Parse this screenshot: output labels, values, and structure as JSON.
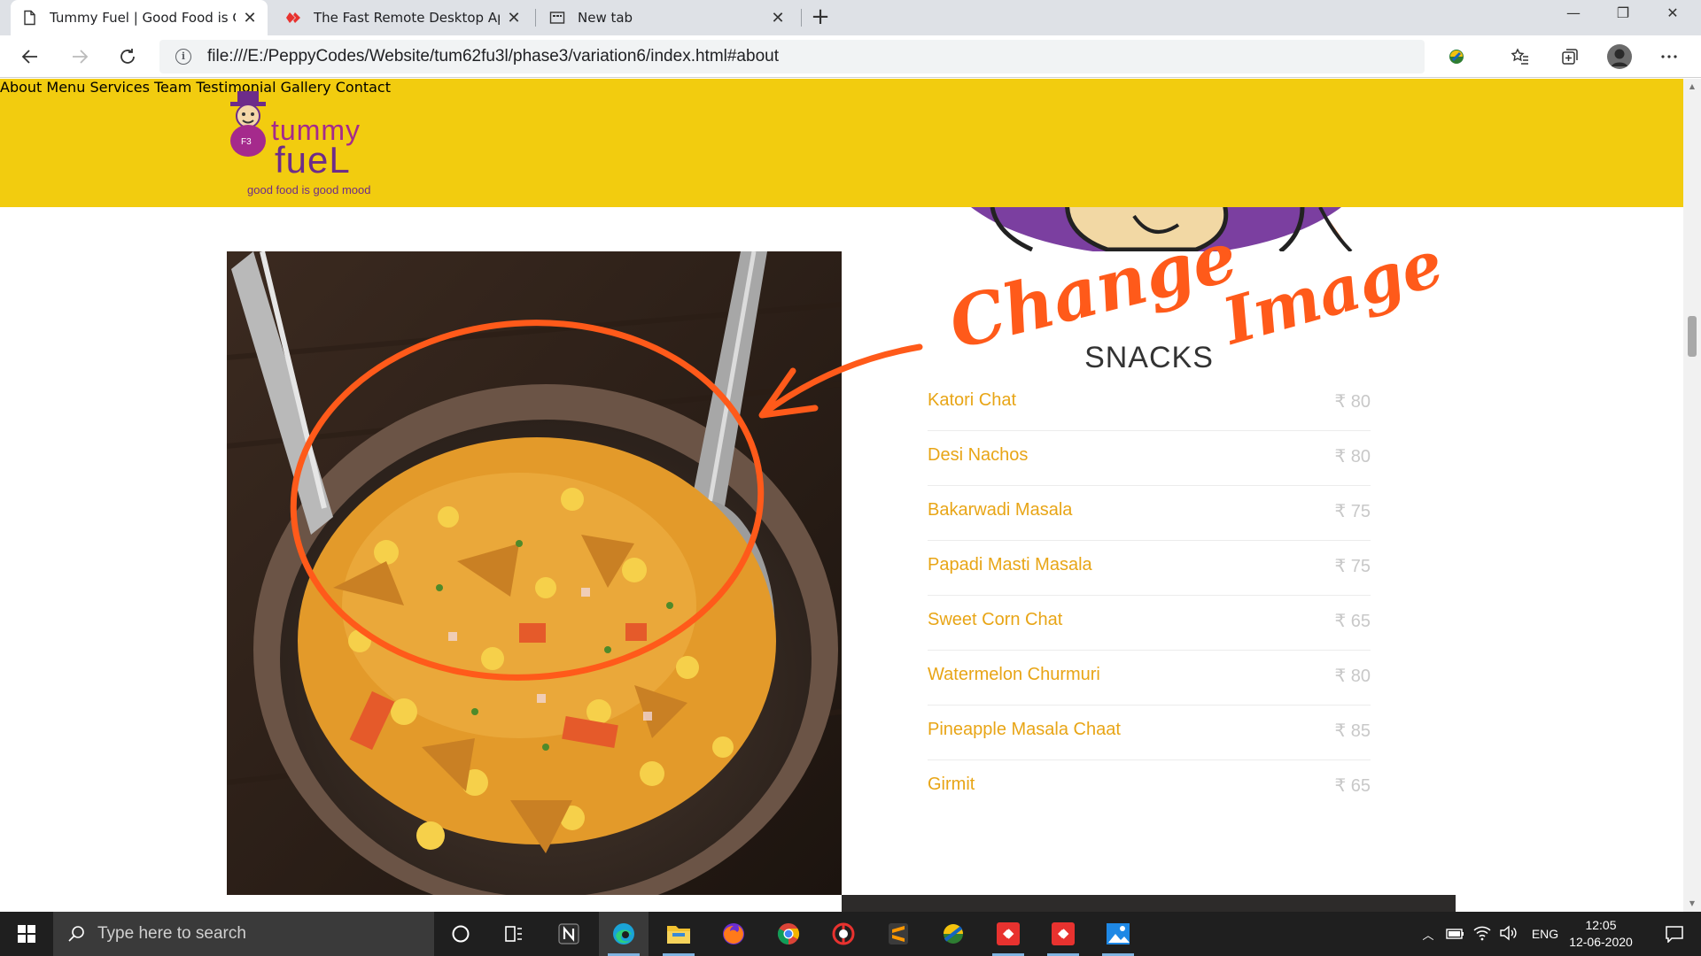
{
  "browser": {
    "tabs": [
      {
        "title": "Tummy Fuel | Good Food is Goo",
        "active": true
      },
      {
        "title": "The Fast Remote Desktop Applic",
        "active": false
      },
      {
        "title": "New tab",
        "active": false
      }
    ],
    "url": "file:///E:/PeppyCodes/Website/tum62fu3l/phase3/variation6/index.html#about"
  },
  "site": {
    "logo": {
      "word1": "tummy",
      "word2": "fueL",
      "tagline": "good food is good mood"
    },
    "nav": [
      "About",
      "Menu",
      "Services",
      "Team",
      "Testimonial",
      "Gallery",
      "Contact"
    ],
    "menu_section": {
      "title": "SNACKS",
      "items": [
        {
          "name": "Katori Chat",
          "price": "₹ 80"
        },
        {
          "name": "Desi Nachos",
          "price": "₹ 80"
        },
        {
          "name": "Bakarwadi Masala",
          "price": "₹ 75"
        },
        {
          "name": "Papadi Masti Masala",
          "price": "₹ 75"
        },
        {
          "name": "Sweet Corn Chat",
          "price": "₹ 65"
        },
        {
          "name": "Watermelon Churmuri",
          "price": "₹ 80"
        },
        {
          "name": "Pineapple Masala Chaat",
          "price": "₹ 85"
        },
        {
          "name": "Girmit",
          "price": "₹ 65"
        }
      ]
    },
    "annotation": {
      "word1": "Change",
      "word2": "Image",
      "color": "#ff5a1a"
    }
  },
  "taskbar": {
    "search_placeholder": "Type here to search",
    "language": "ENG",
    "time": "12:05",
    "date": "12-06-2020"
  },
  "colors": {
    "header": "#f2cc0f",
    "menu_item": "#e8a516",
    "price": "#c8c8c8"
  }
}
